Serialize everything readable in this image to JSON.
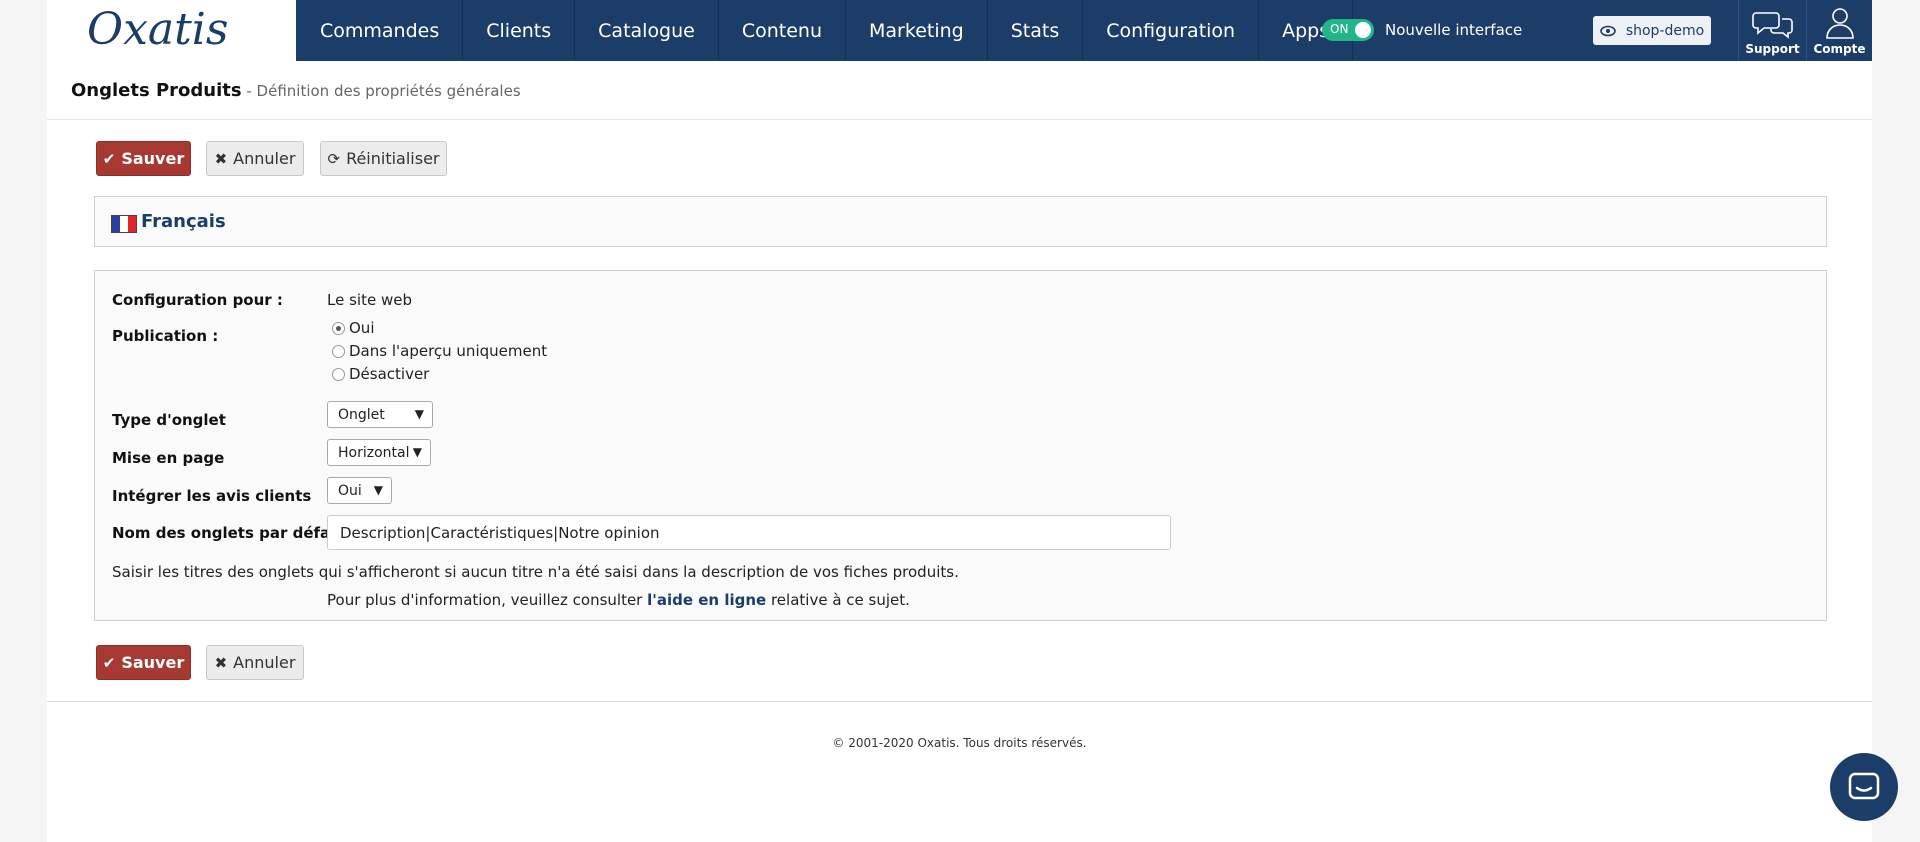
{
  "header": {
    "logo_text": "Oxatis",
    "nav": [
      "Commandes",
      "Clients",
      "Catalogue",
      "Contenu",
      "Marketing",
      "Stats",
      "Configuration",
      "Apps"
    ],
    "toggle_state": "ON",
    "toggle_label": "Nouvelle interface",
    "shop_label": "shop-demo",
    "support_label": "Support",
    "account_label": "Compte"
  },
  "page": {
    "title": "Onglets Produits",
    "subtitle": " - Définition des propriétés générales"
  },
  "buttons": {
    "save": "Sauver",
    "cancel": "Annuler",
    "reset": "Réinitialiser"
  },
  "language": {
    "label": "Français"
  },
  "form": {
    "config_label": "Configuration pour :",
    "config_value": "Le site web",
    "publication_label": "Publication :",
    "publication_options": [
      "Oui",
      "Dans l'aperçu uniquement",
      "Désactiver"
    ],
    "publication_selected": 0,
    "tab_type_label": "Type d'onglet",
    "tab_type_value": "Onglet",
    "layout_label": "Mise en page",
    "layout_value": "Horizontal",
    "reviews_label": "Intégrer les avis clients",
    "reviews_value": "Oui",
    "default_names_label": "Nom des onglets par défaut",
    "default_names_value": "Description|Caractéristiques|Notre opinion",
    "help_text": "Saisir les titres des onglets qui s'afficheront si aucun titre n'a été saisi dans la description de vos fiches produits.",
    "help_more_prefix": "Pour plus d'information, veuillez consulter ",
    "help_link": "l'aide en ligne",
    "help_more_suffix": " relative à ce sujet."
  },
  "footer": {
    "copyright": "© 2001-2020 Oxatis. Tous droits réservés."
  },
  "colors": {
    "nav_bg": "#1b3d68",
    "save_btn": "#a63a33",
    "toggle_on": "#23b58a"
  },
  "icons": [
    "logo-icon",
    "eye-icon",
    "chat-bubbles-icon",
    "user-icon",
    "check-icon",
    "times-icon",
    "refresh-icon",
    "flag-fr-icon",
    "messenger-icon"
  ]
}
